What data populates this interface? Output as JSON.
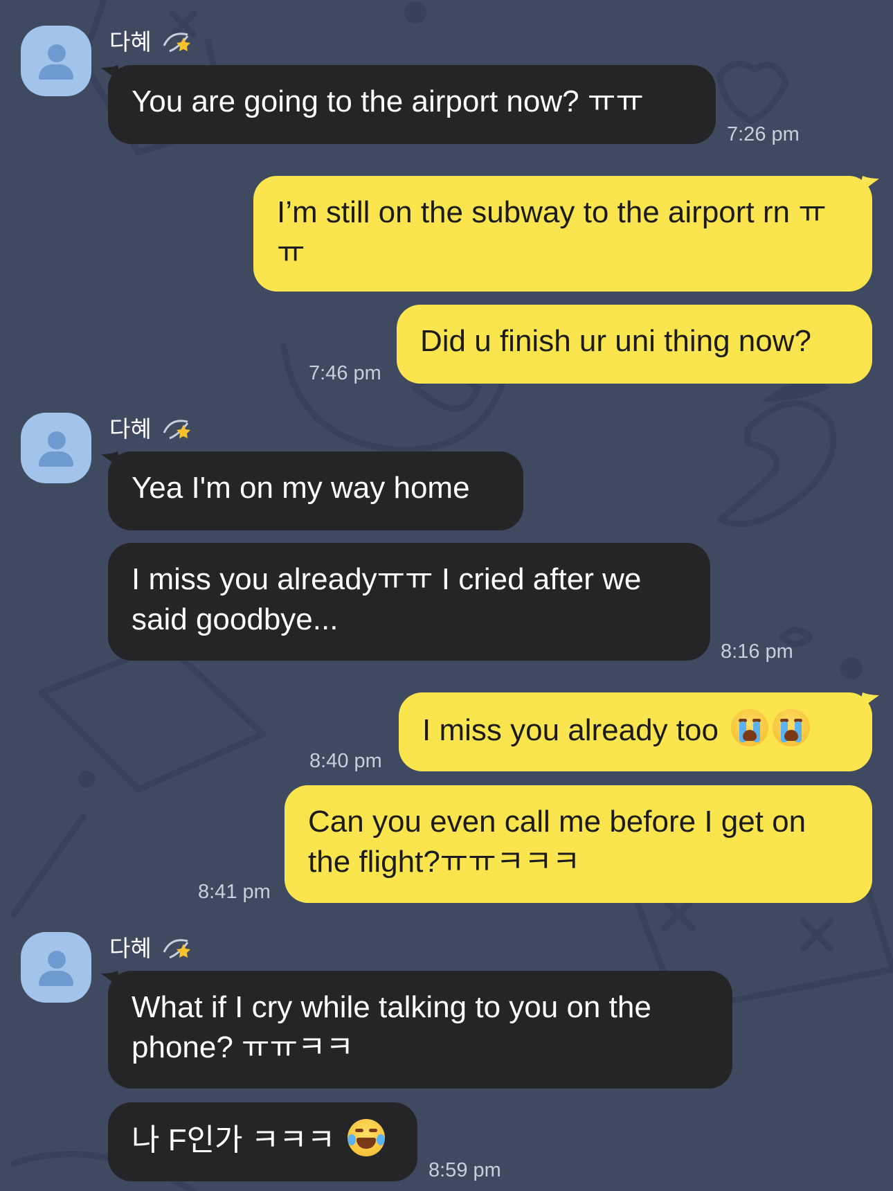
{
  "chat": {
    "sender_name": "다혜",
    "groups": [
      {
        "messages": [
          {
            "text": "You are going to the airport now? ㅠㅠ"
          }
        ],
        "time": "7:26 pm"
      },
      {
        "messages": [
          {
            "text": "I’m still on the subway to the airport rn ㅠㅠ"
          },
          {
            "text": "Did u finish ur uni thing now?"
          }
        ],
        "time": "7:46 pm"
      },
      {
        "messages": [
          {
            "text": "Yea I'm on my way home"
          },
          {
            "text": "I miss you alreadyㅠㅠ I cried after we said goodbye..."
          }
        ],
        "time": "8:16 pm"
      },
      {
        "messages": [
          {
            "text": "I miss you already too",
            "emoji": "loudly-crying-face-icon"
          },
          {
            "text": "Can you even call me before I get on the flight?ㅠㅠㅋㅋㅋ"
          }
        ],
        "time_1": "8:40 pm",
        "time_2": "8:41 pm"
      },
      {
        "messages": [
          {
            "text": "What if I cry while talking to you on the phone? ㅠㅠㅋㅋ"
          },
          {
            "text": "나 F인가 ㅋㅋㅋ",
            "emoji": "face-with-tears-of-joy-icon"
          }
        ],
        "time": "8:59 pm"
      }
    ]
  },
  "colors": {
    "background": "#3f4a61",
    "incoming_bubble": "#252528",
    "outgoing_bubble": "#fae54f",
    "avatar": "#a2c4ea"
  }
}
